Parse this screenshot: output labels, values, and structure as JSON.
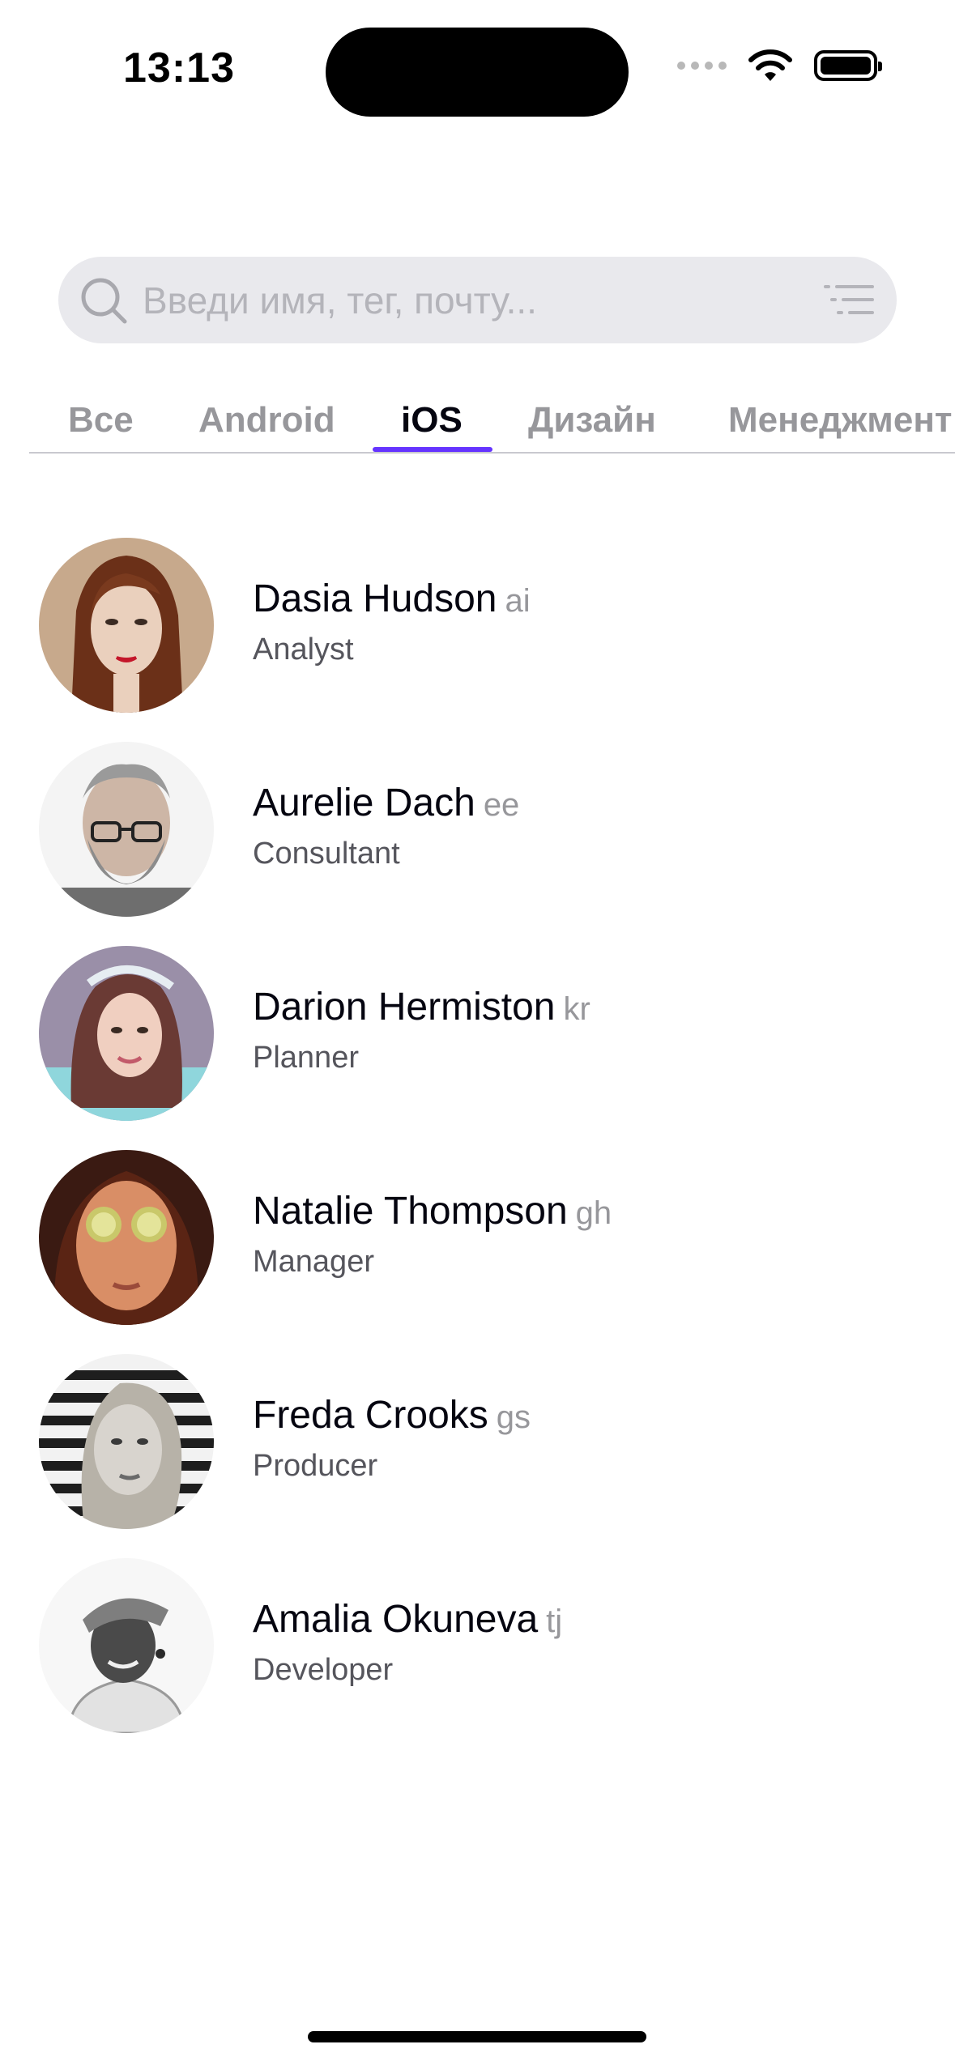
{
  "status_bar": {
    "time": "13:13"
  },
  "search": {
    "placeholder": "Введи имя, тег, почту..."
  },
  "tabs": [
    {
      "label": "Все"
    },
    {
      "label": "Android"
    },
    {
      "label": "iOS"
    },
    {
      "label": "Дизайн"
    },
    {
      "label": "Менеджмент"
    }
  ],
  "active_tab": "iOS",
  "accent_color": "#6534ff",
  "people": [
    {
      "name": "Dasia Hudson",
      "tag": "ai",
      "position": "Analyst"
    },
    {
      "name": "Aurelie Dach",
      "tag": "ee",
      "position": "Consultant"
    },
    {
      "name": "Darion Hermiston",
      "tag": "kr",
      "position": "Planner"
    },
    {
      "name": "Natalie Thompson",
      "tag": "gh",
      "position": "Manager"
    },
    {
      "name": "Freda Crooks",
      "tag": "gs",
      "position": "Producer"
    },
    {
      "name": "Amalia Okuneva",
      "tag": "tj",
      "position": "Developer"
    }
  ]
}
